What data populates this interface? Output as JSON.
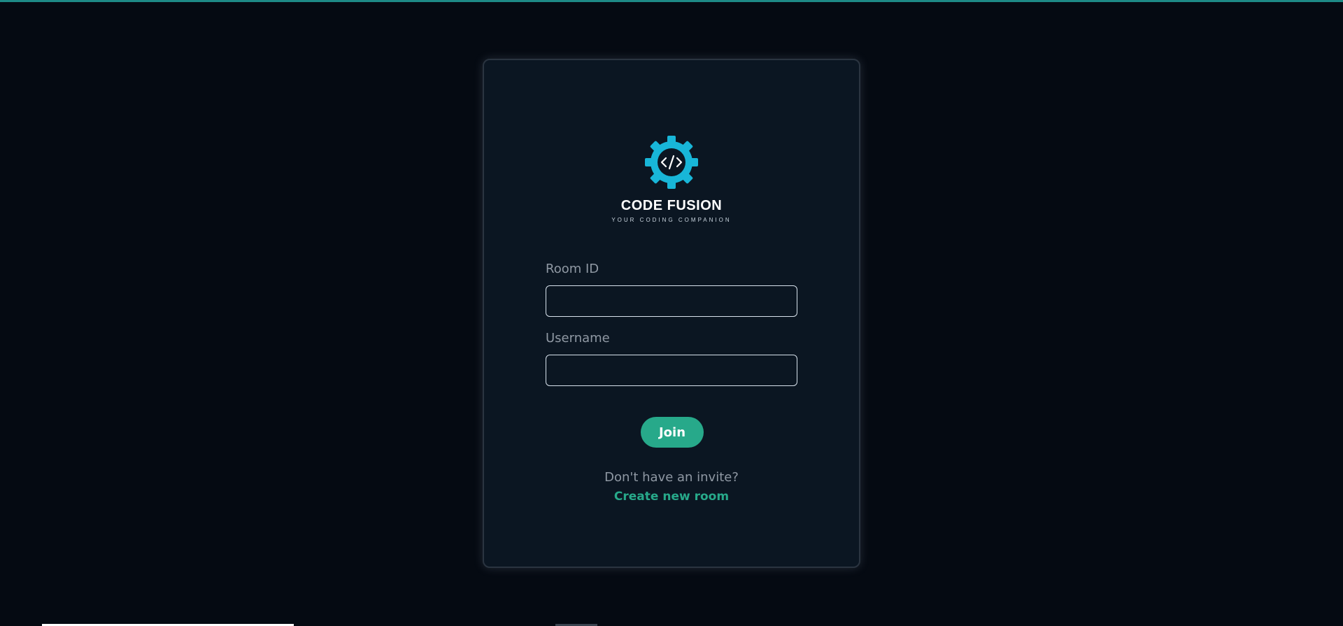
{
  "app": {
    "name": "CODE FUSION",
    "tagline": "YOUR CODING COMPANION"
  },
  "form": {
    "room_id_label": "Room ID",
    "room_id_value": "",
    "username_label": "Username",
    "username_value": "",
    "join_label": "Join"
  },
  "footer": {
    "invite_prompt": "Don't have an invite?",
    "create_link": "Create new room"
  },
  "colors": {
    "background": "#050a12",
    "card": "#0b1622",
    "accent": "#27a98a",
    "logo": "#18b6d8"
  },
  "icons": {
    "logo": "gear-code-icon"
  }
}
